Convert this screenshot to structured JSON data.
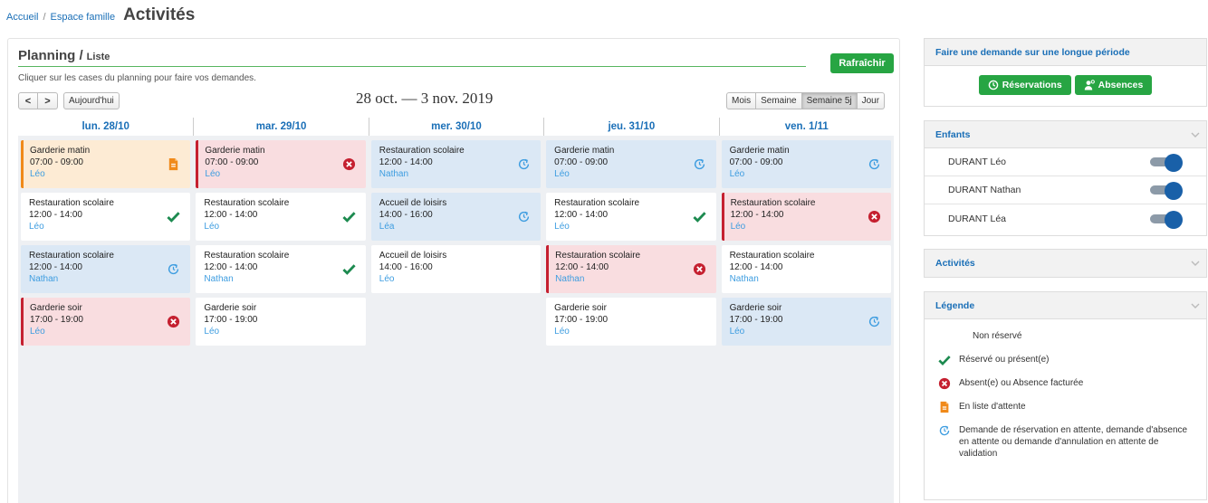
{
  "breadcrumb": {
    "home": "Accueil",
    "separator": "/",
    "space": "Espace famille",
    "title": "Activités"
  },
  "planning": {
    "title": "Planning /",
    "list_link": "Liste",
    "refresh_label": "Rafraîchir",
    "hint": "Cliquer sur les cases du planning pour faire vos demandes.",
    "prev": "<",
    "next": ">",
    "today": "Aujourd'hui",
    "range": "28 oct. — 3 nov. 2019",
    "views": [
      "Mois",
      "Semaine",
      "Semaine 5j",
      "Jour"
    ],
    "active_view": "Semaine 5j"
  },
  "days": [
    {
      "label": "lun. 28/10",
      "events": [
        {
          "title": "Garderie matin",
          "time": "07:00 - 09:00",
          "child": "Léo",
          "style": "orange",
          "status": "waitlist"
        },
        {
          "title": "Restauration scolaire",
          "time": "12:00 - 14:00",
          "child": "Léo",
          "style": "plain",
          "status": "reserved"
        },
        {
          "title": "Restauration scolaire",
          "time": "12:00 - 14:00",
          "child": "Nathan",
          "style": "blue",
          "status": "pending"
        },
        {
          "title": "Garderie soir",
          "time": "17:00 - 19:00",
          "child": "Léo",
          "style": "red",
          "status": "absent"
        }
      ]
    },
    {
      "label": "mar. 29/10",
      "events": [
        {
          "title": "Garderie matin",
          "time": "07:00 - 09:00",
          "child": "Léo",
          "style": "red",
          "status": "absent"
        },
        {
          "title": "Restauration scolaire",
          "time": "12:00 - 14:00",
          "child": "Léo",
          "style": "plain",
          "status": "reserved"
        },
        {
          "title": "Restauration scolaire",
          "time": "12:00 - 14:00",
          "child": "Nathan",
          "style": "plain",
          "status": "reserved"
        },
        {
          "title": "Garderie soir",
          "time": "17:00 - 19:00",
          "child": "Léo",
          "style": "plain",
          "status": "none"
        }
      ]
    },
    {
      "label": "mer. 30/10",
      "events": [
        {
          "title": "Restauration scolaire",
          "time": "12:00 - 14:00",
          "child": "Nathan",
          "style": "blue",
          "status": "pending"
        },
        {
          "title": "Accueil de loisirs",
          "time": "14:00 - 16:00",
          "child": "Léa",
          "style": "blue",
          "status": "pending"
        },
        {
          "title": "Accueil de loisirs",
          "time": "14:00 - 16:00",
          "child": "Léo",
          "style": "plain",
          "status": "none"
        }
      ]
    },
    {
      "label": "jeu. 31/10",
      "events": [
        {
          "title": "Garderie matin",
          "time": "07:00 - 09:00",
          "child": "Léo",
          "style": "blue",
          "status": "pending"
        },
        {
          "title": "Restauration scolaire",
          "time": "12:00 - 14:00",
          "child": "Léo",
          "style": "plain",
          "status": "reserved"
        },
        {
          "title": "Restauration scolaire",
          "time": "12:00 - 14:00",
          "child": "Nathan",
          "style": "red",
          "status": "absent"
        },
        {
          "title": "Garderie soir",
          "time": "17:00 - 19:00",
          "child": "Léo",
          "style": "plain",
          "status": "none"
        }
      ]
    },
    {
      "label": "ven. 1/11",
      "events": [
        {
          "title": "Garderie matin",
          "time": "07:00 - 09:00",
          "child": "Léo",
          "style": "blue",
          "status": "pending"
        },
        {
          "title": "Restauration scolaire",
          "time": "12:00 - 14:00",
          "child": "Léo",
          "style": "red",
          "status": "absent"
        },
        {
          "title": "Restauration scolaire",
          "time": "12:00 - 14:00",
          "child": "Nathan",
          "style": "plain",
          "status": "none"
        },
        {
          "title": "Garderie soir",
          "time": "17:00 - 19:00",
          "child": "Léo",
          "style": "blue",
          "status": "pending"
        }
      ]
    }
  ],
  "sidebar": {
    "request": {
      "title": "Faire une demande sur une longue période",
      "reservations": "Réservations",
      "absences": "Absences"
    },
    "children": {
      "title": "Enfants",
      "items": [
        {
          "name": "DURANT Léo",
          "enabled": true
        },
        {
          "name": "DURANT Nathan",
          "enabled": true
        },
        {
          "name": "DURANT Léa",
          "enabled": true
        }
      ]
    },
    "activities": {
      "title": "Activités"
    },
    "legend": {
      "title": "Légende",
      "items": [
        {
          "icon": "none",
          "text": "Non réservé"
        },
        {
          "icon": "reserved",
          "text": "Réservé ou présent(e)"
        },
        {
          "icon": "absent",
          "text": "Absent(e) ou Absence facturée"
        },
        {
          "icon": "waitlist",
          "text": "En liste d'attente"
        },
        {
          "icon": "pending",
          "text": "Demande de réservation en attente, demande d'absence en attente ou demande d'annulation en attente de validation"
        }
      ]
    }
  },
  "colors": {
    "accent": "#1a6fb7",
    "green": "#27a543",
    "red": "#c52030",
    "orange": "#f08a1a",
    "pending_blue": "#3e9de0",
    "check_green": "#1c8a4f"
  }
}
